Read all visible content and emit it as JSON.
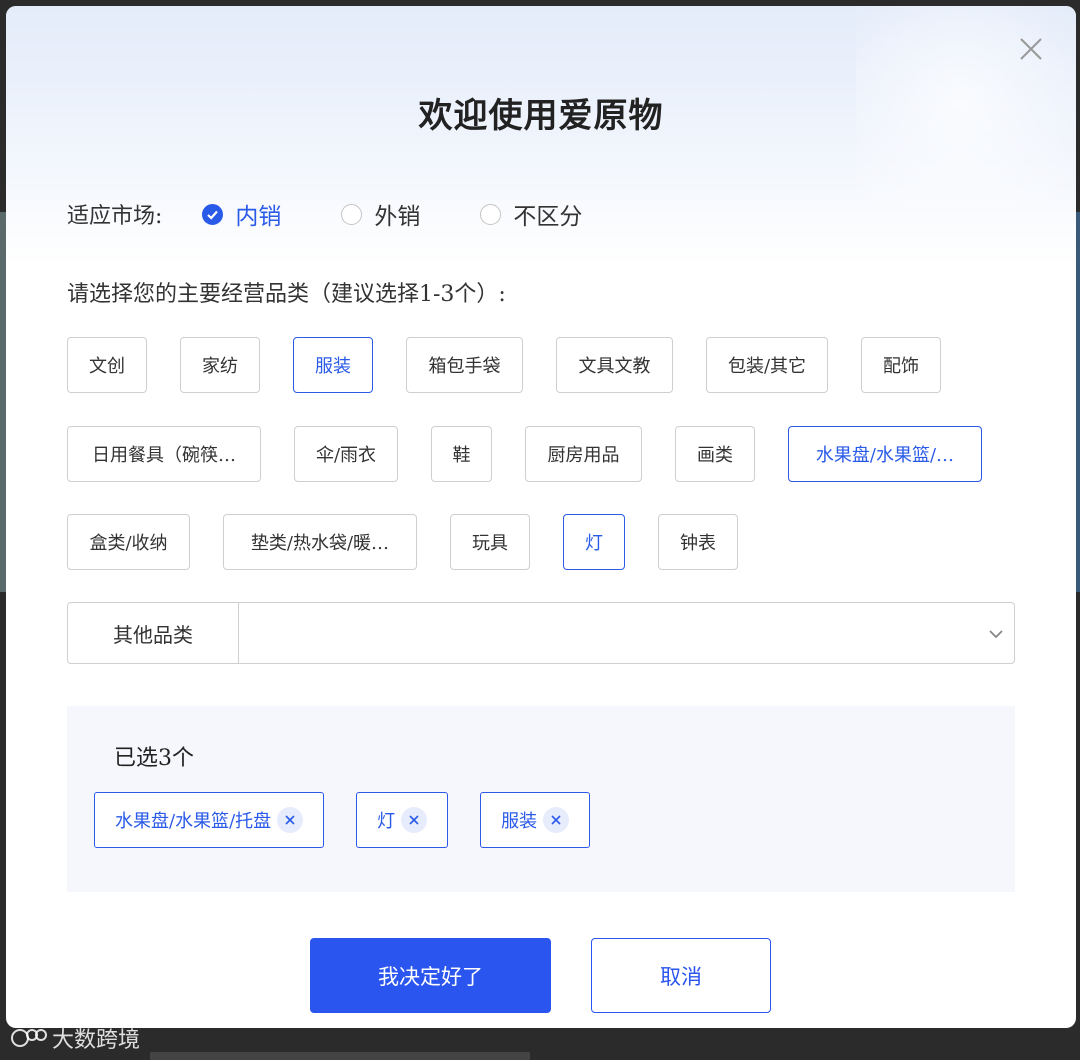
{
  "modal": {
    "title": "欢迎使用爱原物"
  },
  "market": {
    "label": "适应市场:",
    "options": [
      {
        "label": "内销",
        "checked": true
      },
      {
        "label": "外销",
        "checked": false
      },
      {
        "label": "不区分",
        "checked": false
      }
    ]
  },
  "categories": {
    "heading": "请选择您的主要经营品类（建议选择1-3个）:",
    "rows": [
      [
        {
          "label": "文创",
          "active": false
        },
        {
          "label": "家纺",
          "active": false
        },
        {
          "label": "服装",
          "active": true
        },
        {
          "label": "箱包手袋",
          "active": false
        },
        {
          "label": "文具文教",
          "active": false
        },
        {
          "label": "包装/其它",
          "active": false
        },
        {
          "label": "配饰",
          "active": false
        }
      ],
      [
        {
          "label": "日用餐具（碗筷…",
          "active": false
        },
        {
          "label": "伞/雨衣",
          "active": false
        },
        {
          "label": "鞋",
          "active": false
        },
        {
          "label": "厨房用品",
          "active": false
        },
        {
          "label": "画类",
          "active": false
        },
        {
          "label": "水果盘/水果篮/…",
          "active": true
        }
      ],
      [
        {
          "label": "盒类/收纳",
          "active": false
        },
        {
          "label": "垫类/热水袋/暖…",
          "active": false
        },
        {
          "label": "玩具",
          "active": false
        },
        {
          "label": "灯",
          "active": true
        },
        {
          "label": "钟表",
          "active": false
        }
      ]
    ]
  },
  "other": {
    "label": "其他品类",
    "value": ""
  },
  "selected": {
    "count_label": "已选3个",
    "tags": [
      "水果盘/水果篮/托盘",
      "灯",
      "服装"
    ]
  },
  "buttons": {
    "confirm": "我决定好了",
    "cancel": "取消"
  },
  "watermark": "大数跨境",
  "colors": {
    "accent": "#2a55ee",
    "border": "#cfcfcf",
    "panel": "#f5f7fc"
  }
}
